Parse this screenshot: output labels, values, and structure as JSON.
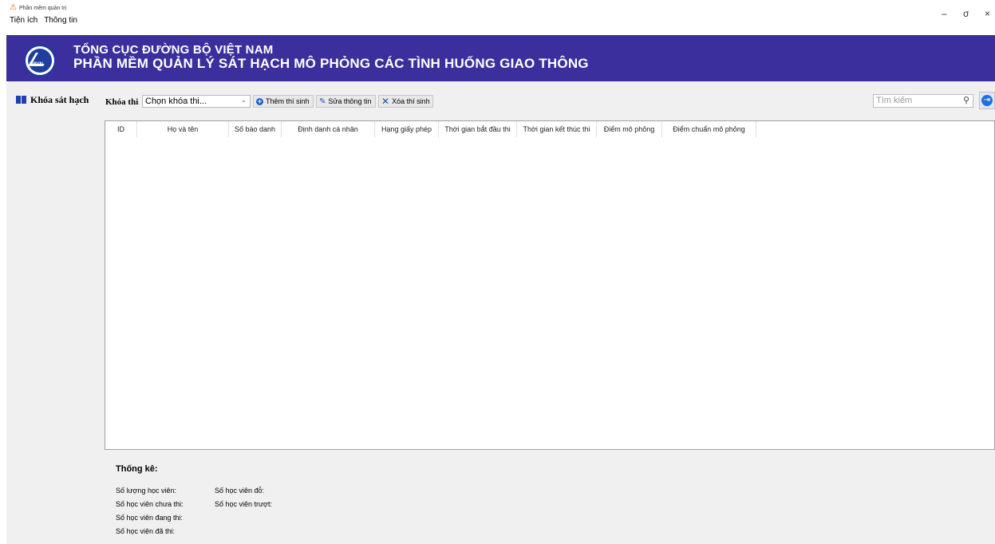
{
  "window": {
    "title": "Phần mềm quản trị",
    "menu": [
      "Tiện ích",
      "Thông tin"
    ],
    "controls": {
      "minimize": "–",
      "restore": "σ",
      "close": "×"
    }
  },
  "banner": {
    "logo_text": "DRVN",
    "title1": "TỔNG CỤC ĐƯỜNG BỘ VIỆT NAM",
    "title2": "PHẦN MỀM QUẢN LÝ SÁT HẠCH MÔ PHỎNG CÁC TÌNH HUỐNG GIAO THÔNG"
  },
  "sidebar": {
    "items": [
      {
        "label": "Khóa sát hạch",
        "icon": "book-icon"
      }
    ]
  },
  "toolbar": {
    "course_label": "Khóa thi",
    "course_select": "Chọn khóa thi...",
    "add_label": "Thêm thí sinh",
    "edit_label": "Sửa thông tin",
    "delete_label": "Xóa thí sinh",
    "search_placeholder": "Tìm kiếm"
  },
  "table": {
    "columns": [
      "ID",
      "Họ và tên",
      "Số báo danh",
      "Định danh cá nhân",
      "Hạng giấy phép",
      "Thời gian bắt đầu thi",
      "Thời gian kết thúc thi",
      "Điểm mô phỏng",
      "Điểm chuẩn mô phỏng"
    ],
    "rows": []
  },
  "stats": {
    "title": "Thống kê:",
    "total": "Số lượng học viên:",
    "not_taken": "Số học viên chưa thi:",
    "in_progress": "Số học viên đang thi:",
    "taken": "Số học viên đã thi:",
    "passed": "Số học viên đỗ:",
    "failed": "Số học viên trượt:"
  },
  "colors": {
    "banner": "#3a2f9c",
    "accent": "#1f6fe0",
    "panel": "#f0f0f0"
  }
}
